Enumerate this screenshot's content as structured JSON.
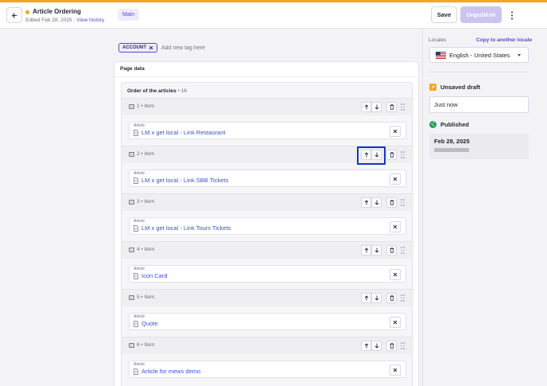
{
  "header": {
    "title": "Article Ordering",
    "subtitle_prefix": "Edited Feb 28, 2025 · ",
    "history_link": "View history",
    "environment_badge": "Main",
    "save_label": "Save",
    "unpublish_label": "Unpublish",
    "status_color": "#f5a524"
  },
  "tags": {
    "items": [
      {
        "label": "ACCOUNT"
      }
    ],
    "input_placeholder": "Add new tag here"
  },
  "page_data": {
    "label": "Page data",
    "order": {
      "title": "Order of the articles",
      "count_text": " • 16",
      "items": [
        {
          "label": "1 • Item",
          "kind": "Article",
          "link": "LM x get local - Link Restaurant"
        },
        {
          "label": "2 • Item",
          "kind": "Article",
          "link": "LM x get local - Link SBB Tickets"
        },
        {
          "label": "3 • Item",
          "kind": "Article",
          "link": "LM x get local - Link Tours Tickets"
        },
        {
          "label": "4 • Item",
          "kind": "Article",
          "link": "Icon Card"
        },
        {
          "label": "5 • Item",
          "kind": "Article",
          "link": "Quote"
        },
        {
          "label": "6 • Item",
          "kind": "Article",
          "link": "Article for mews demo"
        }
      ]
    }
  },
  "sidebar": {
    "locales_label": "Locales",
    "copy_link": "Copy to another locale",
    "locale_selected": "English - United States",
    "draft_title": "Unsaved draft",
    "draft_value": "Just now",
    "published_title": "Published",
    "published_date": "Feb 28, 2025"
  },
  "colors": {
    "accent": "#5548c8",
    "link": "#3b4fc7",
    "focus": "#1833c2",
    "published": "#1f9d55",
    "draft": "#f5a524"
  }
}
